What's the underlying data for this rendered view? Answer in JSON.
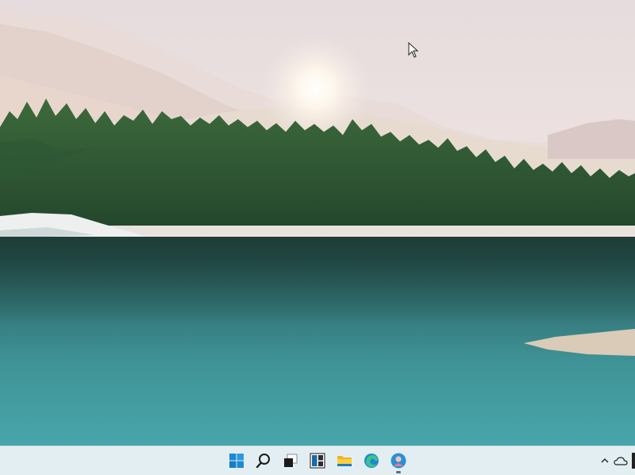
{
  "window": {
    "title": ""
  },
  "desktop": {
    "wallpaper": "lakeside-mountain-forest",
    "cursor": "arrow-cursor-icon"
  },
  "taskbar": {
    "background": "#e3eef2",
    "pinned": [
      {
        "name": "start-button",
        "icon": "windows-logo-icon",
        "running": false
      },
      {
        "name": "search-button",
        "icon": "search-icon",
        "running": false
      },
      {
        "name": "task-view-button",
        "icon": "task-view-icon",
        "running": false
      },
      {
        "name": "widgets-button",
        "icon": "widgets-icon",
        "running": false
      },
      {
        "name": "file-explorer-button",
        "icon": "folder-icon",
        "running": false
      },
      {
        "name": "edge-button",
        "icon": "edge-icon",
        "running": false
      },
      {
        "name": "profile-app-button",
        "icon": "user-avatar-icon",
        "running": true
      }
    ],
    "tray": [
      {
        "name": "show-hidden-icons-button",
        "icon": "chevron-up-icon"
      },
      {
        "name": "onedrive-button",
        "icon": "cloud-icon"
      }
    ]
  }
}
